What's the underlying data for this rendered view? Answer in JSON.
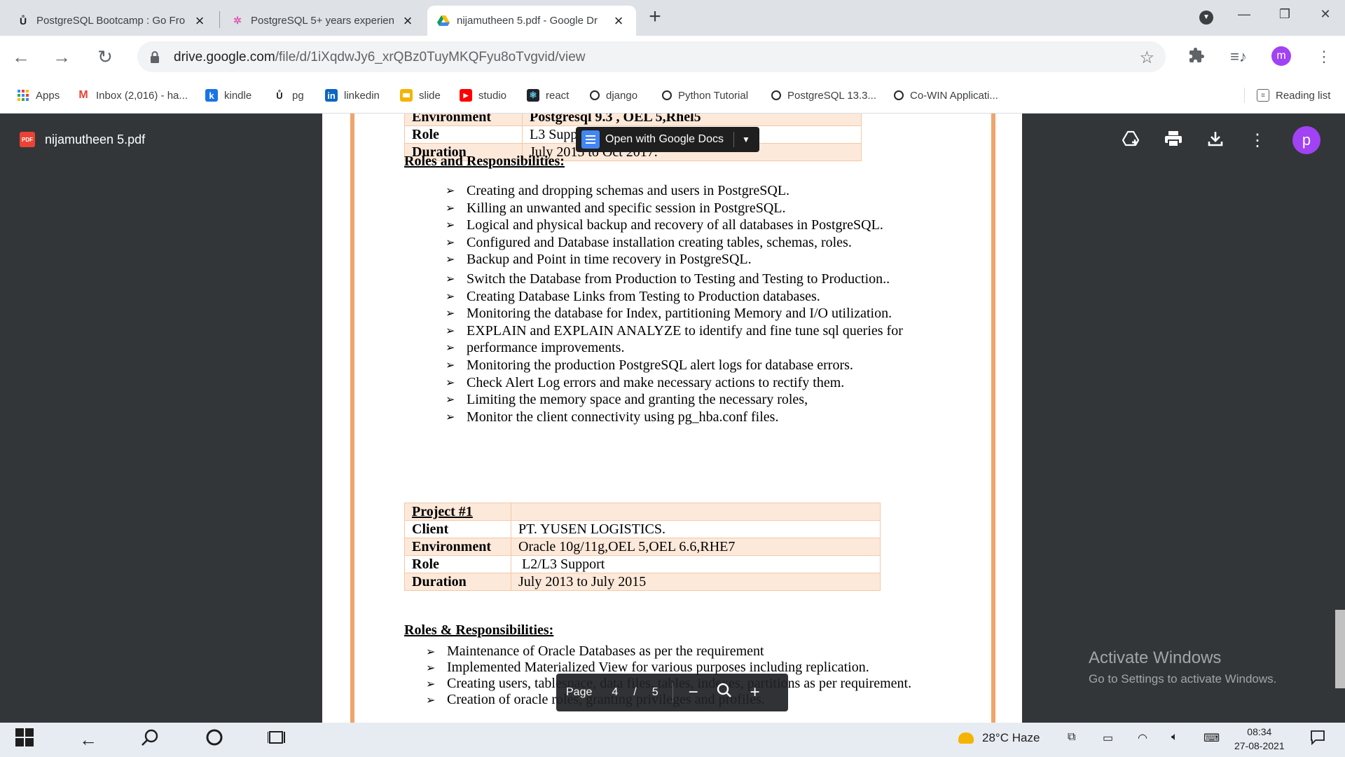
{
  "tabs": [
    {
      "title": "PostgreSQL Bootcamp : Go Fro",
      "favicon": "udemy-icon",
      "active": false
    },
    {
      "title": "PostgreSQL 5+ years experienc",
      "favicon": "naukri-icon",
      "active": false
    },
    {
      "title": "nijamutheen 5.pdf - Google Dr",
      "favicon": "google-drive-icon",
      "active": true
    }
  ],
  "address": {
    "host": "drive.google.com",
    "path": "/file/d/1iXqdwJy6_xrQBz0TuyMKQFyu8oTvgvid/view"
  },
  "profile_initial": "m",
  "bookmarks": [
    {
      "label": "Apps",
      "icon": "apps-grid-icon"
    },
    {
      "label": "Inbox (2,016) - ha...",
      "icon": "gmail-icon"
    },
    {
      "label": "kindle",
      "icon": "kindle-icon"
    },
    {
      "label": "pg",
      "icon": "udemy-icon"
    },
    {
      "label": "linkedin",
      "icon": "linkedin-icon"
    },
    {
      "label": "slide",
      "icon": "slides-icon"
    },
    {
      "label": "studio",
      "icon": "youtube-icon"
    },
    {
      "label": "react",
      "icon": "react-icon"
    },
    {
      "label": "django",
      "icon": "github-icon"
    },
    {
      "label": "Python Tutorial",
      "icon": "github-icon"
    },
    {
      "label": "PostgreSQL 13.3...",
      "icon": "github-icon"
    },
    {
      "label": "Co-WIN Applicati...",
      "icon": "github-icon"
    }
  ],
  "reading_list": "Reading list",
  "viewer": {
    "file_name": "nijamutheen 5.pdf",
    "pdf_badge": "PDF",
    "open_with": "Open with Google Docs",
    "account_initial": "p",
    "page_label": "Page",
    "page_current": "4",
    "page_sep": "/",
    "page_total": "5"
  },
  "document": {
    "top_table": [
      {
        "key": "Environment",
        "value": "Postgresql 9.3 , OEL 5,Rhel5"
      },
      {
        "key": "Role",
        "value": "L3 Support"
      },
      {
        "key": "Duration",
        "value": "July 2015 to Oct 2017."
      }
    ],
    "roles_heading_1": "Roles and Responsibilities:",
    "roles_1": [
      "Creating and dropping schemas and users in PostgreSQL.",
      "Killing an unwanted and specific session in PostgreSQL.",
      "Logical and physical backup and recovery of all databases in PostgreSQL.",
      "Configured and Database installation creating tables, schemas, roles.",
      "Backup and Point in time recovery in PostgreSQL.",
      "Switch the Database from Production to Testing and Testing to Production..",
      "Creating Database Links from Testing to Production databases.",
      "Monitoring the database for Index, partitioning Memory and I/O utilization.",
      "EXPLAIN and EXPLAIN ANALYZE to identify and fine tune sql queries for",
      "Monitoring the production PostgreSQL alert logs for database errors.",
      "Check Alert Log errors and make necessary actions to rectify them.",
      "Limiting the memory space and granting the necessary roles,",
      "Monitor the client connectivity using pg_hba.conf files."
    ],
    "roles_1_continuation": "performance improvements.",
    "project_title": "Project #1",
    "project_table": [
      {
        "key": "Client",
        "value": "PT. YUSEN LOGISTICS."
      },
      {
        "key": "Environment",
        "value": "Oracle 10g/11g,OEL 5,OEL 6.6,RHE7"
      },
      {
        "key": "Role",
        "value": " L2/L3 Support"
      },
      {
        "key": "Duration",
        "value": "July 2013 to July 2015"
      }
    ],
    "roles_heading_2": "Roles & Responsibilities:",
    "roles_2": [
      "Maintenance of Oracle Databases as per the requirement",
      "Implemented Materialized View for various purposes including replication.",
      "Creating users, tablespace, data files, tables, indexes, partitions as per requirement.",
      "Creation of oracle roles, granting privileges and profiles."
    ]
  },
  "activate": {
    "title": "Activate Windows",
    "subtitle": "Go to Settings to activate Windows."
  },
  "taskbar": {
    "weather": "28°C  Haze",
    "time": "08:34",
    "date": "27-08-2021"
  }
}
